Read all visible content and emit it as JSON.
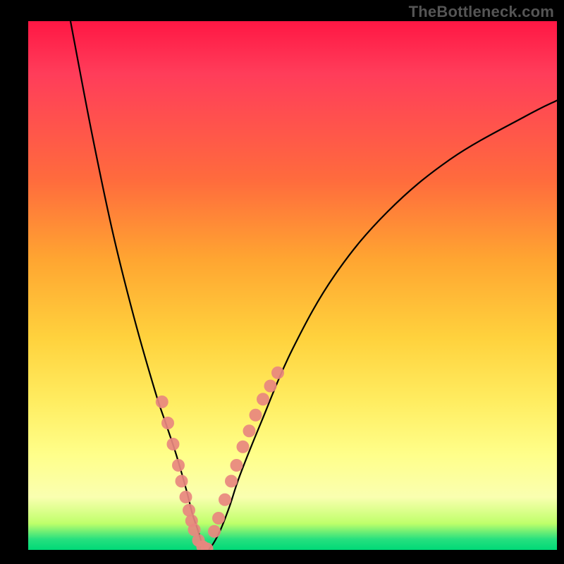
{
  "watermark": {
    "text": "TheBottleneck.com"
  },
  "chart_data": {
    "type": "line",
    "title": "",
    "xlabel": "",
    "ylabel": "",
    "xlim": [
      0,
      100
    ],
    "ylim": [
      0,
      100
    ],
    "grid": false,
    "series": [
      {
        "name": "curve",
        "x": [
          8,
          12,
          16,
          20,
          24,
          26,
          28,
          30,
          31,
          32,
          33,
          34,
          36,
          38,
          40,
          44,
          50,
          58,
          68,
          80,
          94,
          100
        ],
        "y": [
          100,
          79,
          60,
          44,
          30,
          24,
          18,
          11,
          7,
          4,
          1,
          0,
          3,
          8,
          14,
          24,
          38,
          52,
          64,
          74,
          82,
          85
        ]
      }
    ],
    "markers": [
      {
        "name": "marker-cluster-left",
        "x": [
          25.3,
          26.4,
          27.4,
          28.4,
          29.0,
          29.8,
          30.4,
          30.9,
          31.4,
          32.2,
          33.0,
          33.8
        ],
        "y": [
          28.0,
          24.0,
          20.0,
          16.0,
          13.0,
          10.0,
          7.5,
          5.5,
          3.8,
          1.8,
          0.6,
          0.2
        ]
      },
      {
        "name": "marker-cluster-right",
        "x": [
          35.2,
          36.0,
          37.2,
          38.4,
          39.4,
          40.6,
          41.8,
          43.0,
          44.4,
          45.8,
          47.2
        ],
        "y": [
          3.5,
          6.0,
          9.5,
          13.0,
          16.0,
          19.5,
          22.5,
          25.5,
          28.5,
          31.0,
          33.5
        ]
      }
    ]
  }
}
